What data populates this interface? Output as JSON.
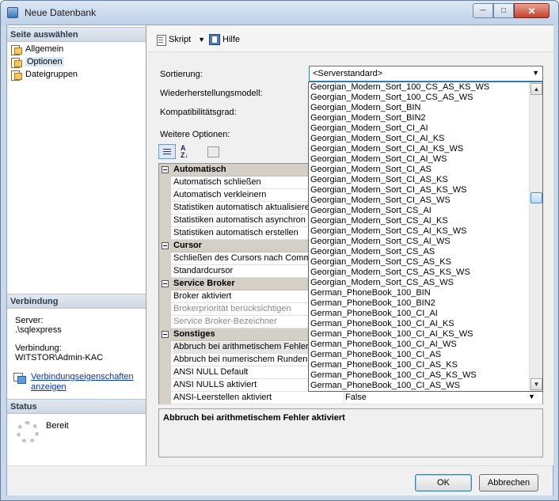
{
  "window": {
    "title": "Neue Datenbank",
    "min": "─",
    "max": "□",
    "close": "✕"
  },
  "left": {
    "pages_header": "Seite auswählen",
    "pages": [
      "Allgemein",
      "Optionen",
      "Dateigruppen"
    ],
    "connection_header": "Verbindung",
    "server_label": "Server:",
    "server_value": ".\\sqlexpress",
    "conn_label": "Verbindung:",
    "conn_value": "WITSTOR\\Admin-KAC",
    "props_link": "Verbindungseigenschaften anzeigen",
    "status_header": "Status",
    "status_value": "Bereit"
  },
  "toolbar": {
    "script": "Skript",
    "help": "Hilfe",
    "dropdown": "▼"
  },
  "form": {
    "sort_label": "Sortierung:",
    "sort_value": "<Serverstandard>",
    "sort_arrow": "▼",
    "recovery_label": "Wiederherstellungsmodell:",
    "compat_label": "Kompatibilitätsgrad:",
    "other_label": "Weitere Optionen:",
    "az": "A\nZ↓"
  },
  "grid": {
    "rows": [
      {
        "type": "cat",
        "name": "Automatisch"
      },
      {
        "type": "item",
        "name": "Automatisch schließen"
      },
      {
        "type": "item",
        "name": "Automatisch verkleinern"
      },
      {
        "type": "item",
        "name": "Statistiken automatisch aktualisieren"
      },
      {
        "type": "item",
        "name": "Statistiken automatisch asynchron aktualisieren"
      },
      {
        "type": "item",
        "name": "Statistiken automatisch erstellen"
      },
      {
        "type": "cat",
        "name": "Cursor"
      },
      {
        "type": "item",
        "name": "Schließen des Cursors nach Commit aktiviert"
      },
      {
        "type": "item",
        "name": "Standardcursor"
      },
      {
        "type": "cat",
        "name": "Service Broker"
      },
      {
        "type": "item",
        "name": "Broker aktiviert"
      },
      {
        "type": "dis",
        "name": "Brokerpriorität berücksichtigen"
      },
      {
        "type": "dis",
        "name": "Service Broker-Bezeichner"
      },
      {
        "type": "cat",
        "name": "Sonstiges"
      },
      {
        "type": "hl",
        "name": "Abbruch bei arithmetischem Fehler aktiviert"
      },
      {
        "type": "item",
        "name": "Abbruch bei numerischem Runden"
      },
      {
        "type": "item",
        "name": "ANSI NULL Default"
      },
      {
        "type": "item",
        "name": "ANSI NULLS aktiviert"
      },
      {
        "type": "item",
        "name": "ANSI-Leerstellen aktiviert",
        "value": "False"
      }
    ],
    "scroll_arrow": "▼"
  },
  "description": "Abbruch bei arithmetischem Fehler aktiviert",
  "dropdown": {
    "options": [
      "Georgian_Modern_Sort_100_CS_AS_KS_WS",
      "Georgian_Modern_Sort_100_CS_AS_WS",
      "Georgian_Modern_Sort_BIN",
      "Georgian_Modern_Sort_BIN2",
      "Georgian_Modern_Sort_CI_AI",
      "Georgian_Modern_Sort_CI_AI_KS",
      "Georgian_Modern_Sort_CI_AI_KS_WS",
      "Georgian_Modern_Sort_CI_AI_WS",
      "Georgian_Modern_Sort_CI_AS",
      "Georgian_Modern_Sort_CI_AS_KS",
      "Georgian_Modern_Sort_CI_AS_KS_WS",
      "Georgian_Modern_Sort_CI_AS_WS",
      "Georgian_Modern_Sort_CS_AI",
      "Georgian_Modern_Sort_CS_AI_KS",
      "Georgian_Modern_Sort_CS_AI_KS_WS",
      "Georgian_Modern_Sort_CS_AI_WS",
      "Georgian_Modern_Sort_CS_AS",
      "Georgian_Modern_Sort_CS_AS_KS",
      "Georgian_Modern_Sort_CS_AS_KS_WS",
      "Georgian_Modern_Sort_CS_AS_WS",
      "German_PhoneBook_100_BIN",
      "German_PhoneBook_100_BIN2",
      "German_PhoneBook_100_CI_AI",
      "German_PhoneBook_100_CI_AI_KS",
      "German_PhoneBook_100_CI_AI_KS_WS",
      "German_PhoneBook_100_CI_AI_WS",
      "German_PhoneBook_100_CI_AS",
      "German_PhoneBook_100_CI_AS_KS",
      "German_PhoneBook_100_CI_AS_KS_WS",
      "German_PhoneBook_100_CI_AS_WS"
    ],
    "up": "▲",
    "down": "▼"
  },
  "buttons": {
    "ok": "OK",
    "cancel": "Abbrechen"
  }
}
